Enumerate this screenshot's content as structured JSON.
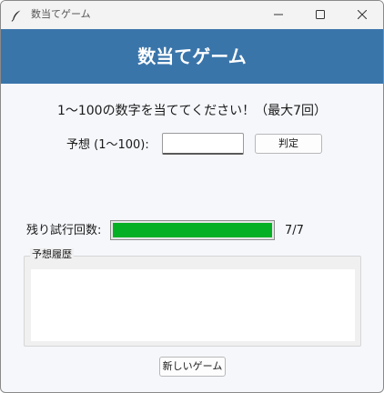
{
  "window": {
    "title": "数当てゲーム"
  },
  "header": {
    "title": "数当てゲーム",
    "background": "#3a75aa"
  },
  "game": {
    "instructions": "1〜100の数字を当ててください！（最大7回）",
    "guess_label": "予想 (1〜100):",
    "guess_value": "",
    "judge_label": "判定",
    "remaining_label": "残り試行回数:",
    "remaining_text": "7/7",
    "remaining_fraction": 1.0,
    "progress_color": "#06b025"
  },
  "history": {
    "legend": "予想履歴",
    "entries": []
  },
  "footer": {
    "new_game_label": "新しいゲーム"
  },
  "icons": {
    "app": "feather-icon",
    "minimize": "minimize-icon",
    "maximize": "maximize-icon",
    "close": "close-icon"
  }
}
